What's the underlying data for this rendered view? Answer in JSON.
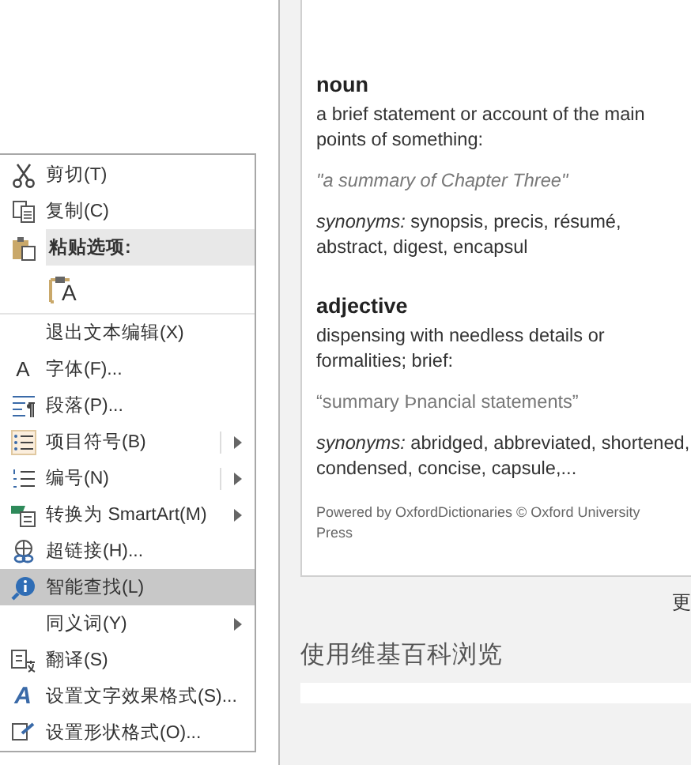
{
  "context_menu": {
    "items": [
      {
        "kind": "command",
        "label": "剪切(T)",
        "submenu": false,
        "split": false,
        "selected": false
      },
      {
        "kind": "command",
        "label": "复制(C)",
        "submenu": false,
        "split": false,
        "selected": false
      },
      {
        "kind": "header",
        "label": "粘贴选项:",
        "submenu": false,
        "split": false,
        "selected": false
      },
      {
        "kind": "paste-options",
        "glyph": "A",
        "submenu": false,
        "split": false,
        "selected": false
      },
      {
        "kind": "command",
        "label": "退出文本编辑(X)",
        "submenu": false,
        "split": false,
        "selected": false
      },
      {
        "kind": "command",
        "glyph": "A",
        "label": "字体(F)...",
        "submenu": false,
        "split": false,
        "selected": false
      },
      {
        "kind": "command",
        "label": "段落(P)...",
        "submenu": false,
        "split": false,
        "selected": false
      },
      {
        "kind": "command",
        "label": "项目符号(B)",
        "submenu": true,
        "split": true,
        "selected": false
      },
      {
        "kind": "command",
        "label": "编号(N)",
        "submenu": true,
        "split": true,
        "selected": false
      },
      {
        "kind": "command",
        "label": "转换为 SmartArt(M)",
        "submenu": true,
        "split": false,
        "selected": false
      },
      {
        "kind": "command",
        "label": "超链接(H)...",
        "submenu": false,
        "split": false,
        "selected": false
      },
      {
        "kind": "command",
        "label": "智能查找(L)",
        "submenu": false,
        "split": false,
        "selected": true
      },
      {
        "kind": "command",
        "label": "同义词(Y)",
        "submenu": true,
        "split": false,
        "selected": false
      },
      {
        "kind": "command",
        "label": "翻译(S)",
        "submenu": false,
        "split": false,
        "selected": false
      },
      {
        "kind": "command",
        "glyph": "A",
        "label": "设置文字效果格式(S)...",
        "submenu": false,
        "split": false,
        "selected": false
      },
      {
        "kind": "command",
        "label": "设置形状格式(O)...",
        "submenu": false,
        "split": false,
        "selected": false
      }
    ]
  },
  "definition_card": {
    "entries": [
      {
        "part_of_speech": "noun",
        "meaning": "a brief statement or account of the main points of something:",
        "example": "\"a summary of Chapter Three\"",
        "synonyms": "*synonyms:* synopsis, precis, résumé, abstract, digest, encapsul"
      },
      {
        "part_of_speech": "adjective",
        "meaning": "dispensing with needless details or formalities; brief:",
        "example": "“summary Þnancial statements”",
        "synonyms": "*synonyms:* abridged, abbreviated, shortened, condensed, concise, capsule,..."
      }
    ],
    "credit": "Powered by OxfordDictionaries © Oxford University Press"
  },
  "more_link": "更",
  "wiki_heading": "使用维基百科浏览"
}
